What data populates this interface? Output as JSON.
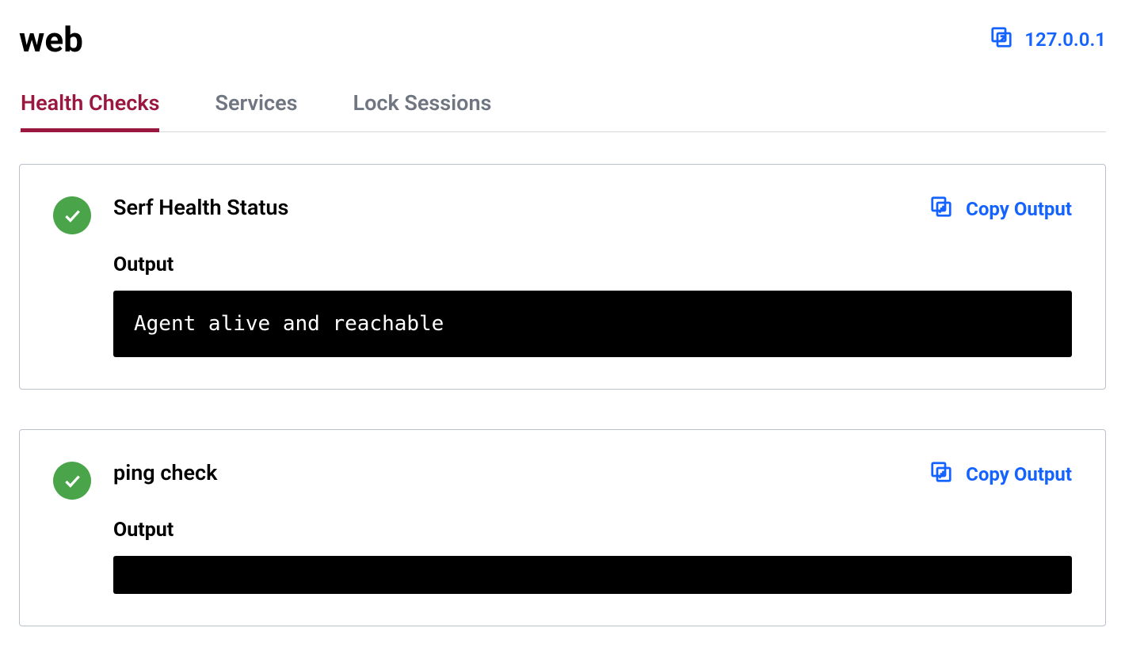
{
  "header": {
    "title": "web",
    "ip": "127.0.0.1"
  },
  "tabs": {
    "health_checks": "Health Checks",
    "services": "Services",
    "lock_sessions": "Lock Sessions"
  },
  "copy_output_label": "Copy Output",
  "output_label": "Output",
  "checks": [
    {
      "name": "Serf Health Status",
      "status": "passing",
      "output": "Agent alive and reachable"
    },
    {
      "name": "ping check",
      "status": "passing",
      "output": ""
    }
  ]
}
